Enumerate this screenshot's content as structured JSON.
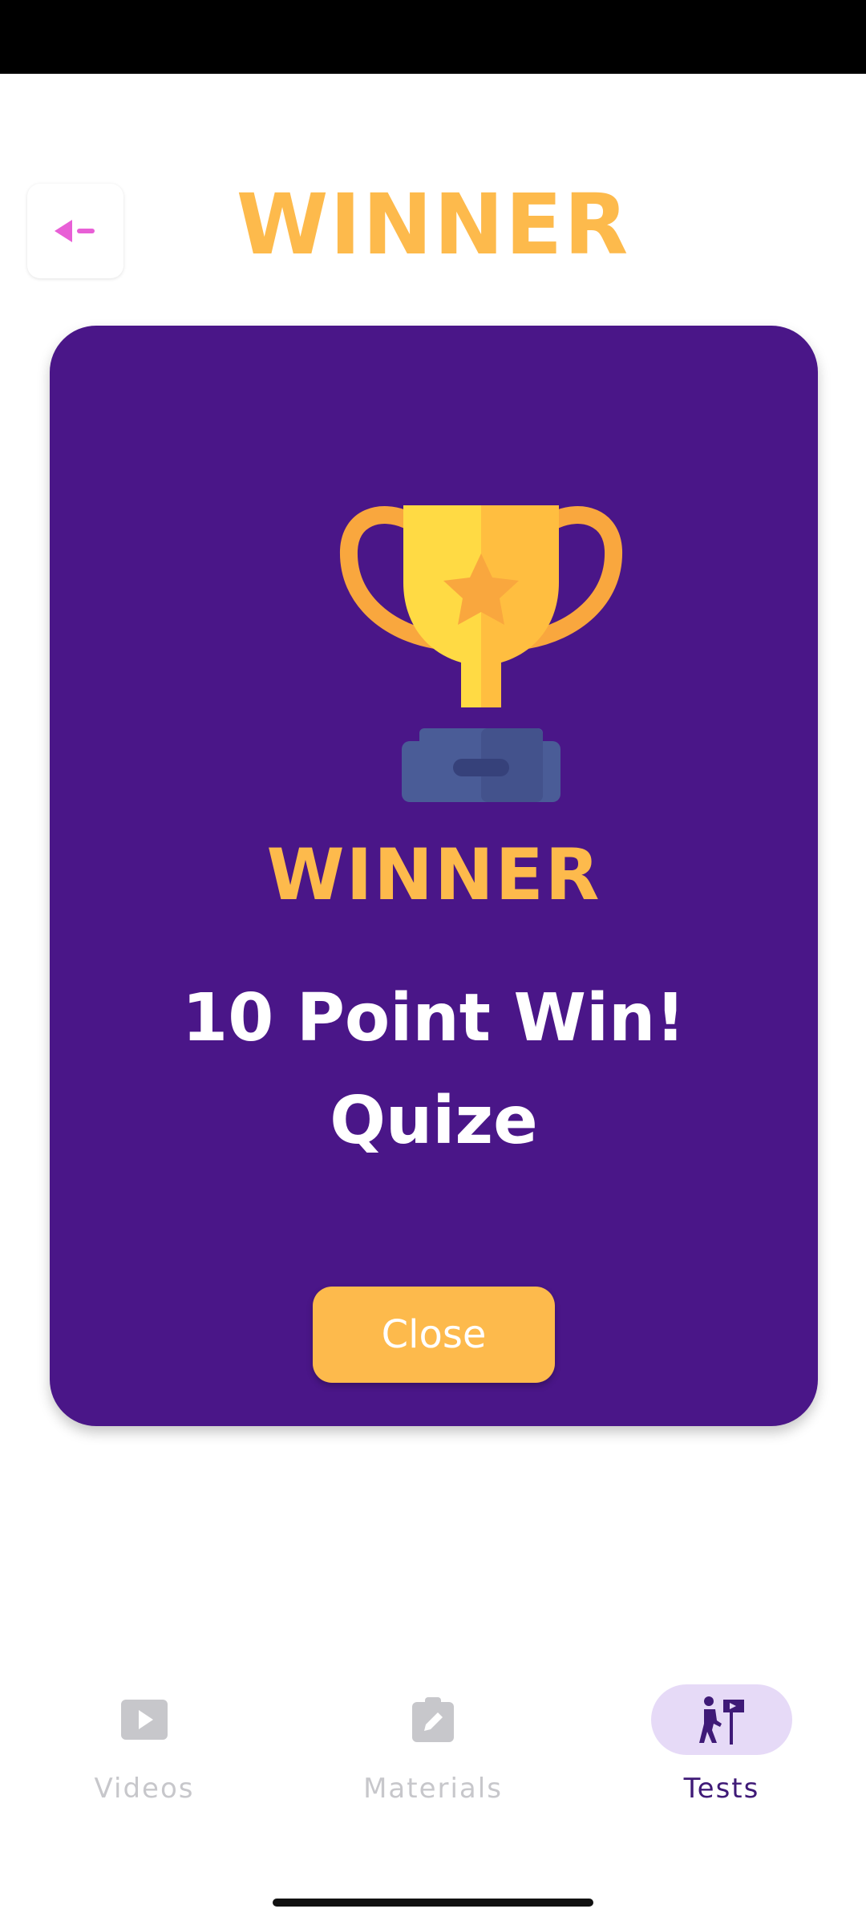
{
  "header": {
    "title": "WINNER"
  },
  "card": {
    "title": "WINNER",
    "message_line1": "10 Point Win!",
    "message_line2": "Quize",
    "close_label": "Close",
    "icon": "trophy-icon"
  },
  "bottom_nav": {
    "items": [
      {
        "label": "Videos",
        "icon": "play-icon",
        "active": false
      },
      {
        "label": "Materials",
        "icon": "clipboard-edit-icon",
        "active": false
      },
      {
        "label": "Tests",
        "icon": "hiker-signpost-icon",
        "active": true
      }
    ]
  },
  "colors": {
    "accent": "#FDBA4C",
    "card_background": "#4A1688",
    "back_arrow": "#E85FD6",
    "nav_active_bg": "#E6DAF7",
    "nav_active": "#3F1A77",
    "nav_inactive": "#C7C7CB"
  }
}
